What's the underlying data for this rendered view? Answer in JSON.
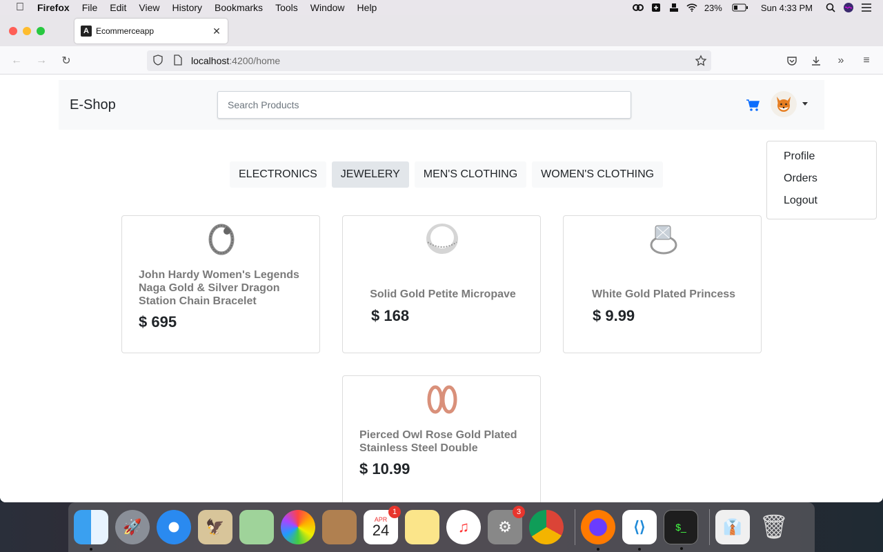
{
  "menubar": {
    "app_name": "Firefox",
    "items": [
      "File",
      "Edit",
      "View",
      "History",
      "Bookmarks",
      "Tools",
      "Window",
      "Help"
    ],
    "battery": "23%",
    "clock": "Sun 4:33 PM"
  },
  "browser": {
    "tab_title": "Ecommerceapp",
    "url_host": "localhost",
    "url_path": ":4200/home"
  },
  "shop": {
    "brand": "E-Shop",
    "search_placeholder": "Search Products",
    "categories": [
      "ELECTRONICS",
      "JEWELERY",
      "MEN'S CLOTHING",
      "WOMEN'S CLOTHING"
    ],
    "active_category": "JEWELERY",
    "user_menu": [
      "Profile",
      "Orders",
      "Logout"
    ],
    "products": [
      {
        "title": "John Hardy Women's Legends Naga Gold & Silver Dragon Station Chain Bracelet",
        "price": "$ 695"
      },
      {
        "title": "Solid Gold Petite Micropave",
        "price": "$ 168"
      },
      {
        "title": "White Gold Plated Princess",
        "price": "$ 9.99"
      },
      {
        "title": "Pierced Owl Rose Gold Plated Stainless Steel Double",
        "price": "$ 10.99"
      }
    ],
    "colors": {
      "cart": "#0d6efd",
      "nav_bg": "#f8f9fa",
      "active_cat": "#e2e6ea"
    }
  },
  "dock": {
    "calendar_month": "APR",
    "calendar_day": "24",
    "calendar_badge": "1",
    "settings_badge": "3"
  }
}
